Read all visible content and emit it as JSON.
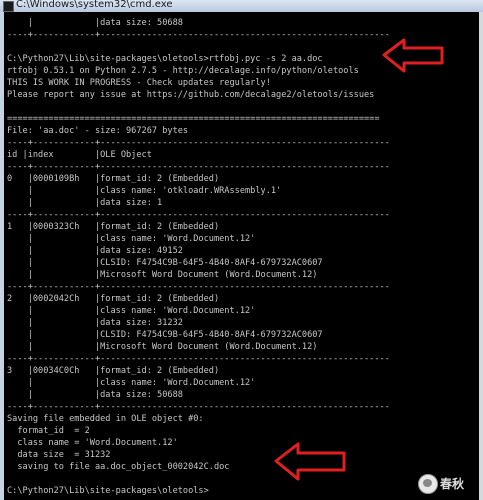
{
  "window": {
    "title": "C:\\Windows\\system32\\cmd.exe",
    "icon": "console-icon"
  },
  "console": {
    "lines": [
      "    |            |data size: 50688",
      "----+------------+--------------------------------------------------------",
      "",
      "C:\\Python27\\Lib\\site-packages\\oletools>rtfobj.pyc -s 2 aa.doc",
      "rtfobj 0.53.1 on Python 2.7.5 - http://decalage.info/python/oletools",
      "THIS IS WORK IN PROGRESS - Check updates regularly!",
      "Please report any issue at https://github.com/decalage2/oletools/issues",
      "",
      "========================================================================",
      "File: 'aa.doc' - size: 967267 bytes",
      "----+------------+--------------------------------------------------------",
      "id |index        |OLE Object",
      "----+------------+--------------------------------------------------------",
      "0   |0000109Bh   |format_id: 2 (Embedded)",
      "    |            |class name: 'otkloadr.WRAssembly.1'",
      "    |            |data size: 1",
      "----+------------+--------------------------------------------------------",
      "1   |0000323Ch   |format_id: 2 (Embedded)",
      "    |            |class name: 'Word.Document.12'",
      "    |            |data size: 49152",
      "    |            |CLSID: F4754C9B-64F5-4B40-8AF4-679732AC0607",
      "    |            |Microsoft Word Document (Word.Document.12)",
      "----+------------+--------------------------------------------------------",
      "2   |0002042Ch   |format_id: 2 (Embedded)",
      "    |            |class name: 'Word.Document.12'",
      "    |            |data size: 31232",
      "    |            |CLSID: F4754C9B-64F5-4B40-8AF4-679732AC0607",
      "    |            |Microsoft Word Document (Word.Document.12)",
      "----+------------+--------------------------------------------------------",
      "3   |00034C0Ch   |format_id: 2 (Embedded)",
      "    |            |class name: 'Word.Document.12'",
      "    |            |data size: 50688",
      "----+------------+--------------------------------------------------------",
      "Saving file embedded in OLE object #0:",
      "  format_id  = 2",
      "  class name = 'Word.Document.12'",
      "  data size  = 31232",
      "  saving to file aa.doc_object_0002042C.doc",
      "",
      "C:\\Python27\\Lib\\site-packages\\oletools>"
    ]
  },
  "annotations": {
    "arrow_color": "#e02020"
  },
  "watermark": {
    "text": "春秋"
  }
}
